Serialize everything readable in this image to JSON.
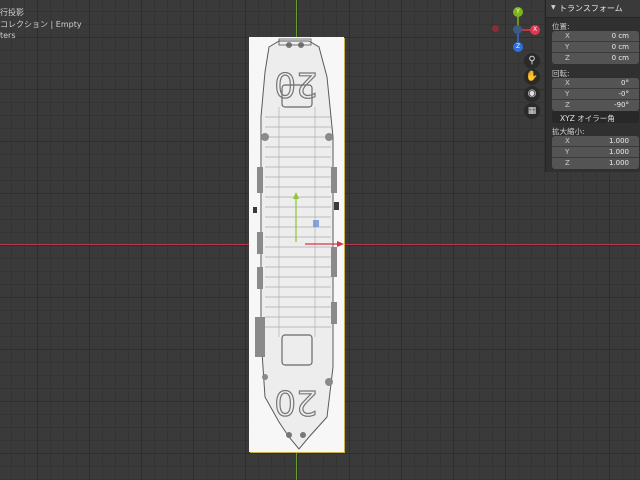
{
  "viewport": {
    "projection_text": "行投影",
    "collection_text": "コレクション | Empty",
    "third_line_text": "ters"
  },
  "gizmo": {
    "y_label": "Y",
    "x_label": "X",
    "z_label": "Z",
    "x_color": "#e0374f",
    "y_color": "#7cb518",
    "z_color": "#2f6fdb"
  },
  "nav_buttons": [
    "zoom-icon",
    "hand-icon",
    "camera-icon",
    "grid-icon"
  ],
  "reference_image": {
    "deck_number_top": "20",
    "deck_number_bottom": "20"
  },
  "panel": {
    "title": "トランスフォーム",
    "location": {
      "label": "位置:",
      "fields": [
        {
          "axis": "X",
          "value": "0 cm"
        },
        {
          "axis": "Y",
          "value": "0 cm"
        },
        {
          "axis": "Z",
          "value": "0 cm"
        }
      ]
    },
    "rotation": {
      "label": "回転:",
      "fields": [
        {
          "axis": "X",
          "value": "0°"
        },
        {
          "axis": "Y",
          "value": "-0°"
        },
        {
          "axis": "Z",
          "value": "-90°"
        }
      ],
      "mode": "XYZ オイラー角"
    },
    "scale": {
      "label": "拡大縮小:",
      "fields": [
        {
          "axis": "X",
          "value": "1.000"
        },
        {
          "axis": "Y",
          "value": "1.000"
        },
        {
          "axis": "Z",
          "value": "1.000"
        }
      ]
    }
  }
}
